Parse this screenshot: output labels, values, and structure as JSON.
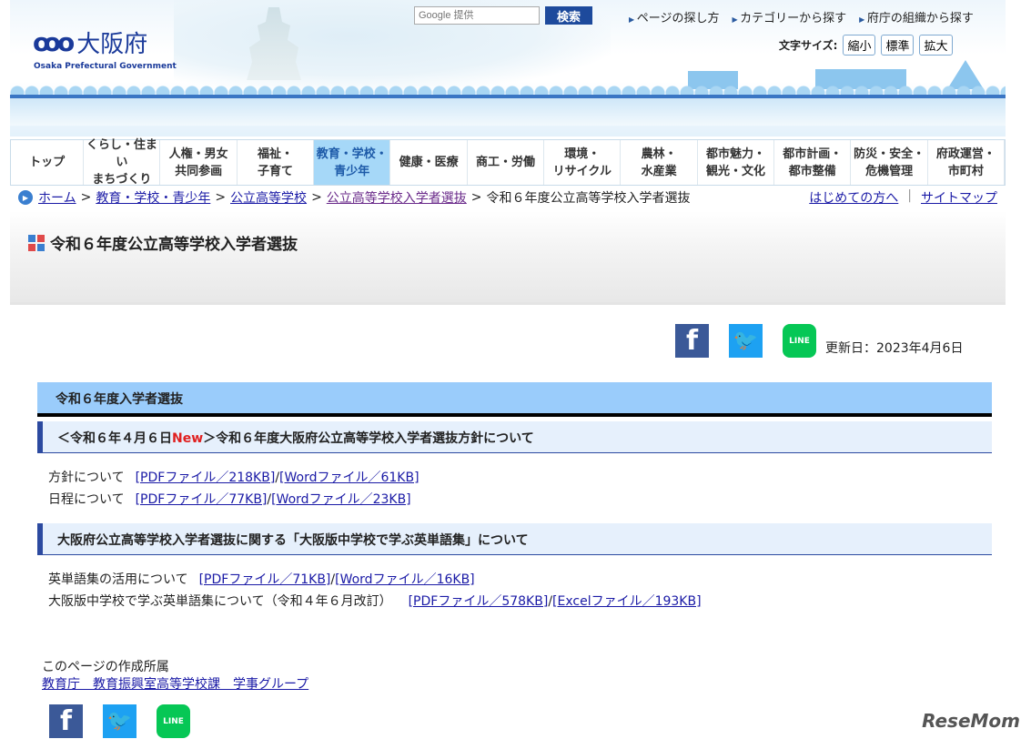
{
  "header": {
    "logo_jp": "大阪府",
    "logo_en": "Osaka Prefectural Government",
    "search_placeholder": "Google 提供",
    "search_button": "検索",
    "top_links": [
      "ページの探し方",
      "カテゴリーから探す",
      "府庁の組織から探す"
    ],
    "font_size_label": "文字サイズ:",
    "font_buttons": [
      "縮小",
      "標準",
      "拡大"
    ]
  },
  "nav": [
    [
      "トップ"
    ],
    [
      "くらし・住まい",
      "まちづくり"
    ],
    [
      "人権・男女",
      "共同参画"
    ],
    [
      "福祉・",
      "子育て"
    ],
    [
      "教育・学校・",
      "青少年"
    ],
    [
      "健康・医療"
    ],
    [
      "商工・労働"
    ],
    [
      "環境・",
      "リサイクル"
    ],
    [
      "農林・",
      "水産業"
    ],
    [
      "都市魅力・",
      "観光・文化"
    ],
    [
      "都市計画・",
      "都市整備"
    ],
    [
      "防災・安全・",
      "危機管理"
    ],
    [
      "府政運営・",
      "市町村"
    ]
  ],
  "nav_active": 4,
  "breadcrumb": {
    "items": [
      "ホーム",
      "教育・学校・青少年",
      "公立高等学校",
      "公立高等学校入学者選抜"
    ],
    "current": "令和６年度公立高等学校入学者選抜",
    "right": [
      "はじめての方へ",
      "サイトマップ"
    ]
  },
  "page_title": "令和６年度公立高等学校入学者選抜",
  "social": {
    "facebook": "f",
    "twitter": "t",
    "line": "LINE"
  },
  "updated": "更新日：2023年4月6日",
  "section": {
    "title": "令和６年度入学者選抜",
    "sub1": {
      "prefix": "＜令和６年４月６日",
      "new": "New",
      "suffix": "＞令和６年度大阪府公立高等学校入学者選抜方針について",
      "rows": [
        {
          "label": "方針について",
          "links": [
            "[PDFファイル／218KB]",
            "[Wordファイル／61KB]"
          ]
        },
        {
          "label": "日程について",
          "links": [
            "[PDFファイル／77KB]",
            "[Wordファイル／23KB]"
          ]
        }
      ]
    },
    "sub2": {
      "title": "大阪府公立高等学校入学者選抜に関する「大阪版中学校で学ぶ英単語集」について",
      "rows": [
        {
          "label": "英単語集の活用について",
          "links": [
            "[PDFファイル／71KB]",
            "[Wordファイル／16KB]"
          ]
        },
        {
          "label": "大阪版中学校で学ぶ英単語集について（令和４年６月改訂）",
          "links": [
            "[PDFファイル／578KB]",
            "[Excelファイル／193KB]"
          ]
        }
      ]
    }
  },
  "footer": {
    "label": "このページの作成所属",
    "dept": "教育庁　教育振興室高等学校課　学事グループ"
  },
  "watermark": "ReseMom",
  "colors": {
    "section_bg": "#9accfb",
    "sub_bg": "#e6f0fc",
    "accent": "#2c4aa0",
    "new": "#e02020"
  }
}
